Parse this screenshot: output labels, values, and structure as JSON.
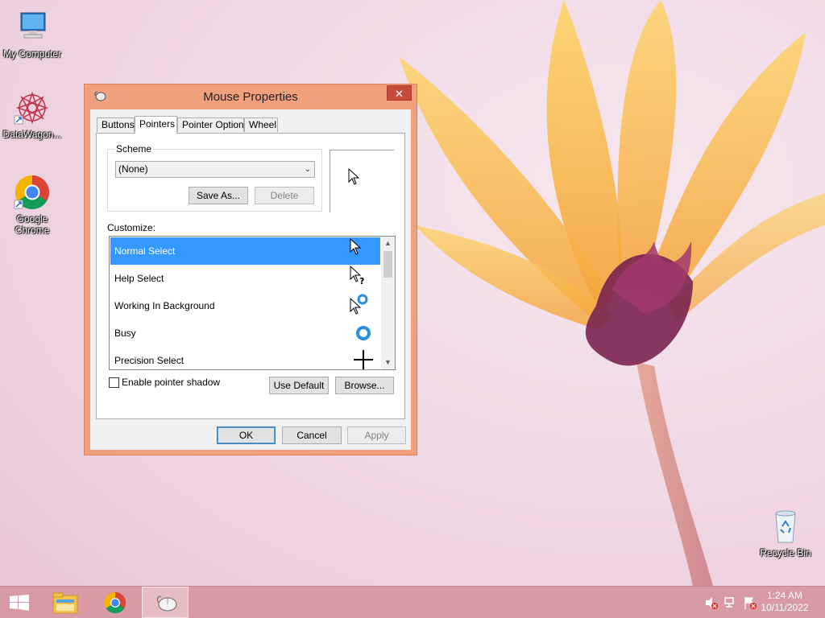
{
  "desktop": {
    "icons": [
      {
        "label": "My Computer"
      },
      {
        "label": "DataWagon..."
      },
      {
        "label_line1": "Google",
        "label_line2": "Chrome"
      },
      {
        "label": "Recycle Bin"
      }
    ]
  },
  "dialog": {
    "title": "Mouse Properties",
    "close_glyph": "✕",
    "tabs": [
      "Buttons",
      "Pointers",
      "Pointer Options",
      "Wheel"
    ],
    "active_tab": "Pointers",
    "scheme": {
      "group_label": "Scheme",
      "selected": "(None)",
      "save_as_label": "Save As...",
      "delete_label": "Delete"
    },
    "customize_label": "Customize:",
    "pointers": [
      {
        "name": "Normal Select",
        "icon": "arrow-cursor-icon",
        "selected": true
      },
      {
        "name": "Help Select",
        "icon": "help-cursor-icon"
      },
      {
        "name": "Working In Background",
        "icon": "working-cursor-icon"
      },
      {
        "name": "Busy",
        "icon": "busy-cursor-icon"
      },
      {
        "name": "Precision Select",
        "icon": "crosshair-cursor-icon"
      }
    ],
    "enable_shadow_label": "Enable pointer shadow",
    "enable_shadow_checked": false,
    "use_default_label": "Use Default",
    "browse_label": "Browse...",
    "ok_label": "OK",
    "cancel_label": "Cancel",
    "apply_label": "Apply"
  },
  "taskbar": {
    "items": [
      "start-icon",
      "file-explorer-icon",
      "chrome-icon",
      "mouse-properties-icon"
    ],
    "time": "1:24 AM",
    "date": "10/11/2022"
  },
  "colors": {
    "selection": "#3399ff",
    "dialog_frame": "#f0a07c",
    "close_button": "#c74b3c",
    "taskbar": "#d696a0"
  }
}
